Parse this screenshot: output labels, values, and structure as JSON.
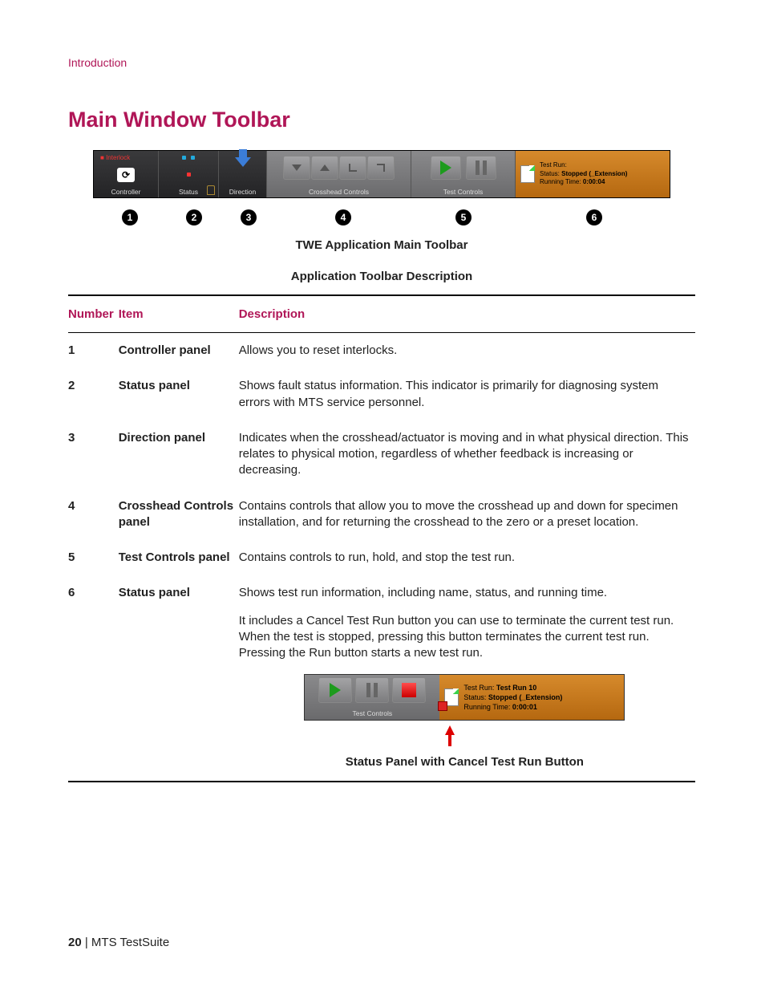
{
  "header": {
    "chapter": "Introduction"
  },
  "section": {
    "title": "Main Window Toolbar"
  },
  "toolbar_fig": {
    "interlock_label": "Interlock",
    "controller_label": "Controller",
    "status_label": "Status",
    "direction_label": "Direction",
    "crosshead_label": "Crosshead Controls",
    "test_controls_label": "Test Controls",
    "info": {
      "run_label": "Test Run:",
      "run_value": "",
      "status_label": "Status:",
      "status_value": "Stopped (_Extension)",
      "time_label": "Running Time:",
      "time_value": "0:00:04"
    },
    "callouts": [
      "1",
      "2",
      "3",
      "4",
      "5",
      "6"
    ]
  },
  "captions": {
    "fig1": "TWE Application Main Toolbar",
    "fig2": "Application Toolbar Description",
    "fig3": "Status Panel with Cancel Test Run Button"
  },
  "table": {
    "headers": {
      "number": "Number",
      "item": "Item",
      "description": "Description"
    },
    "rows": [
      {
        "num": "1",
        "item": "Controller panel",
        "desc": "Allows you to reset interlocks."
      },
      {
        "num": "2",
        "item": "Status panel",
        "desc": "Shows fault status information. This indicator is primarily for diagnosing system errors with MTS service personnel."
      },
      {
        "num": "3",
        "item": "Direction panel",
        "desc": "Indicates when the crosshead/actuator is moving and in what physical direction. This relates to physical motion, regardless of whether feedback is increasing or decreasing."
      },
      {
        "num": "4",
        "item": "Crosshead Controls panel",
        "desc": "Contains controls that allow you to move the crosshead up and down for specimen installation, and for returning the crosshead to the zero or a preset location."
      },
      {
        "num": "5",
        "item": "Test Controls panel",
        "desc": "Contains controls to run, hold, and stop the test run."
      },
      {
        "num": "6",
        "item": "Status panel",
        "desc": "Shows test run information, including name, status, and running time.",
        "extra": "It includes a Cancel Test Run button you can use to terminate the current test run. When the test is stopped, pressing this button terminates the current test run. Pressing the Run button starts a new test run."
      }
    ]
  },
  "panel2": {
    "test_controls_label": "Test Controls",
    "info": {
      "run_label": "Test Run:",
      "run_value": "Test Run 10",
      "status_label": "Status:",
      "status_value": "Stopped (_Extension)",
      "time_label": "Running Time:",
      "time_value": "0:00:01"
    }
  },
  "footer": {
    "page": "20",
    "sep": " | ",
    "product": "MTS TestSuite"
  }
}
